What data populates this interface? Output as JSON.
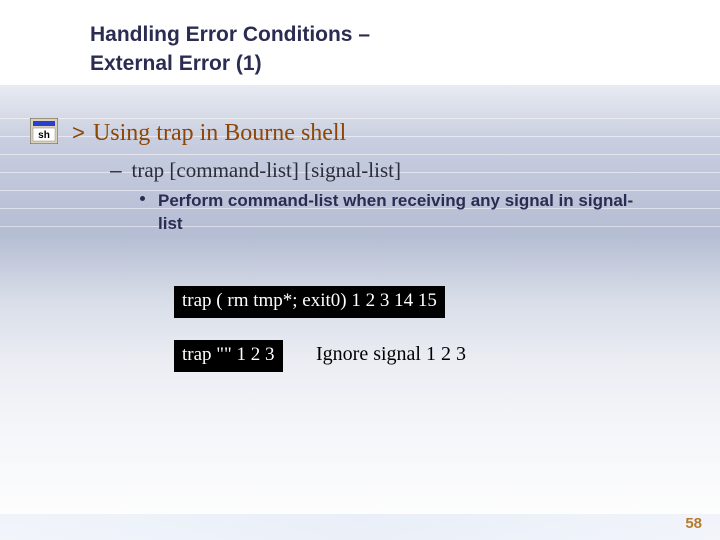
{
  "title_line1": "Handling Error Conditions –",
  "title_line2": "External Error (1)",
  "bullet1": "Using trap in Bourne shell",
  "sub1": "trap [command-list] [signal-list]",
  "sub2": "Perform command-list when receiving any signal in signal-list",
  "code1": "trap ( rm tmp*; exit0) 1 2 3 14 15",
  "code2": "trap \"\" 1 2 3",
  "note": "Ignore signal 1 2 3",
  "page": "58",
  "icon_label": "sh"
}
